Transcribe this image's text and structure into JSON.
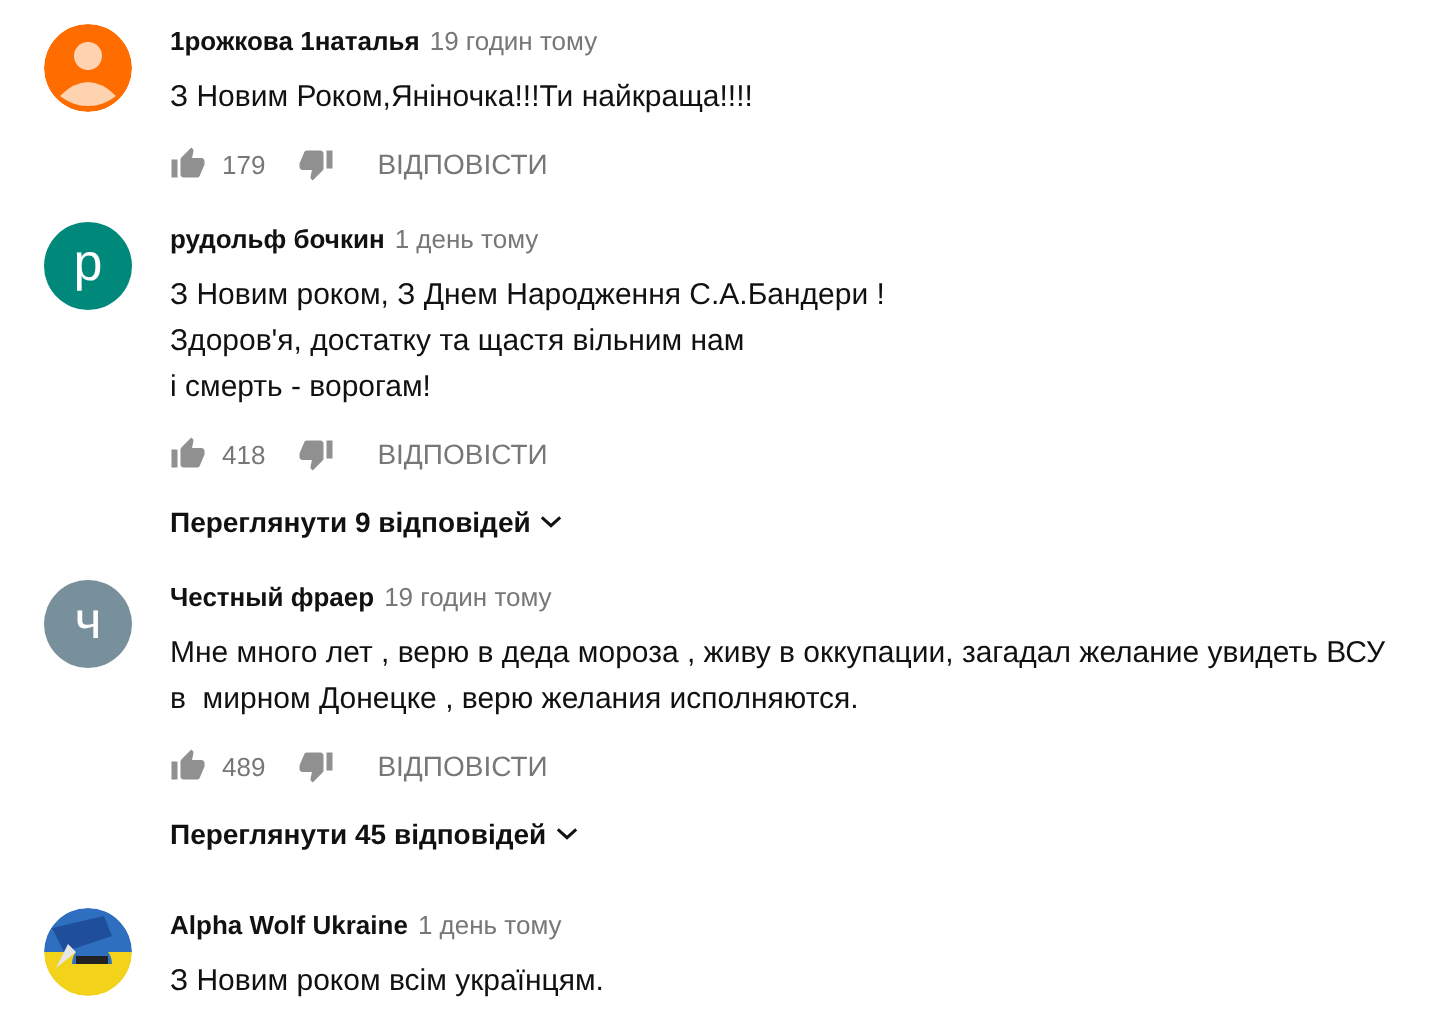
{
  "comments": [
    {
      "author": "1рожкова 1наталья",
      "time": "19 годин тому",
      "avatar": {
        "kind": "default",
        "color": "#ff6d00"
      },
      "lines": [
        "З Новим Роком,Яніночка!!!Ти найкраща!!!!"
      ],
      "likes": "179",
      "reply": "ВІДПОВІСТИ"
    },
    {
      "author": "рудольф бочкин",
      "time": "1 день тому",
      "avatar": {
        "kind": "letter",
        "color": "#00897b",
        "letter": "р"
      },
      "lines": [
        "З Новим роком, З Днем Народження С.А.Бандери !",
        "Здоров'я, достатку та щастя вільним нам",
        "і смерть - ворогам!"
      ],
      "likes": "418",
      "reply": "ВІДПОВІСТИ",
      "replies": "Переглянути 9 відповідей"
    },
    {
      "author": "Честный фраер",
      "time": "19 годин тому",
      "avatar": {
        "kind": "letter",
        "color": "#78909c",
        "letter": "ч"
      },
      "lines": [
        "Мне много лет , верю в деда мороза , живу в оккупации, загадал желание увидеть ВСУ",
        "в  мирном Донецке , верю желания исполняются."
      ],
      "likes": "489",
      "reply": "ВІДПОВІСТИ",
      "replies": "Переглянути 45 відповідей"
    },
    {
      "author": "Alpha Wolf Ukraine",
      "time": "1 день тому",
      "avatar": {
        "kind": "picture"
      },
      "lines": [
        "З Новим роком всім українцям."
      ]
    }
  ]
}
